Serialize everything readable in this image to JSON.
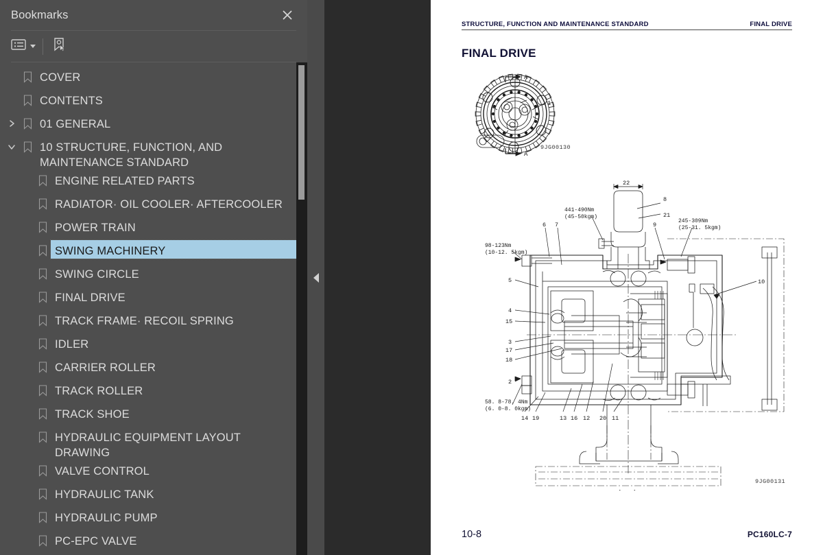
{
  "sidebar": {
    "title": "Bookmarks",
    "close_icon": "close-icon",
    "toolbar": {
      "list_options_label": "list-options",
      "list_options_icon": "bookmark-list-icon",
      "dropdown_icon": "chevron-down-icon",
      "new_bookmark_icon": "new-bookmark-icon"
    },
    "items": [
      {
        "label": "COVER",
        "level": 0,
        "twisty": "none",
        "selected": false
      },
      {
        "label": "CONTENTS",
        "level": 0,
        "twisty": "none",
        "selected": false
      },
      {
        "label": "01 GENERAL",
        "level": 0,
        "twisty": "collapsed",
        "selected": false
      },
      {
        "label": "10 STRUCTURE, FUNCTION, AND MAINTENANCE STANDARD",
        "level": 0,
        "twisty": "expanded",
        "selected": false
      },
      {
        "label": "ENGINE RELATED PARTS",
        "level": 1,
        "twisty": "none",
        "selected": false
      },
      {
        "label": "RADIATOR· OIL COOLER· AFTERCOOLER",
        "level": 1,
        "twisty": "none",
        "selected": false
      },
      {
        "label": "POWER TRAIN",
        "level": 1,
        "twisty": "none",
        "selected": false
      },
      {
        "label": "SWING MACHINERY",
        "level": 1,
        "twisty": "none",
        "selected": true
      },
      {
        "label": "SWING CIRCLE",
        "level": 1,
        "twisty": "none",
        "selected": false
      },
      {
        "label": "FINAL DRIVE",
        "level": 1,
        "twisty": "none",
        "selected": false
      },
      {
        "label": "TRACK FRAME· RECOIL SPRING",
        "level": 1,
        "twisty": "none",
        "selected": false
      },
      {
        "label": "IDLER",
        "level": 1,
        "twisty": "none",
        "selected": false
      },
      {
        "label": "CARRIER ROLLER",
        "level": 1,
        "twisty": "none",
        "selected": false
      },
      {
        "label": "TRACK ROLLER",
        "level": 1,
        "twisty": "none",
        "selected": false
      },
      {
        "label": "TRACK SHOE",
        "level": 1,
        "twisty": "none",
        "selected": false
      },
      {
        "label": "HYDRAULIC EQUIPMENT LAYOUT DRAWING",
        "level": 1,
        "twisty": "none",
        "selected": false
      },
      {
        "label": "VALVE CONTROL",
        "level": 1,
        "twisty": "none",
        "selected": false
      },
      {
        "label": "HYDRAULIC TANK",
        "level": 1,
        "twisty": "none",
        "selected": false
      },
      {
        "label": "HYDRAULIC PUMP",
        "level": 1,
        "twisty": "none",
        "selected": false
      },
      {
        "label": "PC-EPC VALVE",
        "level": 1,
        "twisty": "none",
        "selected": false
      }
    ]
  },
  "splitter": {
    "collapse_icon": "triangle-left-icon"
  },
  "document": {
    "header_left": "STRUCTURE, FUNCTION AND MAINTENANCE STANDARD",
    "header_right": "FINAL DRIVE",
    "title": "FINAL DRIVE",
    "figure1": {
      "code": "9JG00130",
      "section_marks": [
        "A",
        "A"
      ],
      "callouts": [
        "1"
      ]
    },
    "figure2": {
      "code": "9JG00131",
      "section_label": "A – A",
      "dimension": "22",
      "torque_notes": [
        {
          "line1": "441–490Nm",
          "line2": "(45–50kgm)"
        },
        {
          "line1": "245–309Nm",
          "line2": "(25–31. 5kgm)"
        },
        {
          "line1": "98–123Nm",
          "line2": "(10–12. 5kgm)"
        },
        {
          "line1": "58. 8–78. 4Nm",
          "line2": "(6. 0–8. 0kgm)"
        }
      ],
      "callouts_top": [
        "8",
        "21",
        "9",
        "6",
        "7"
      ],
      "callouts_left": [
        "5",
        "4",
        "15",
        "3",
        "17",
        "18",
        "2"
      ],
      "callouts_bottom": [
        "14",
        "19",
        "13",
        "16",
        "12",
        "20",
        "11"
      ],
      "callouts_right": [
        "10"
      ]
    },
    "footer_left": "10-8",
    "footer_right": "PC160LC-7"
  },
  "colors": {
    "sidebar_bg": "#4e4e4e",
    "selection": "#a6cee5",
    "viewer_bg": "#2b2b2b",
    "page_bg": "#ffffff",
    "doc_text": "#101033"
  }
}
